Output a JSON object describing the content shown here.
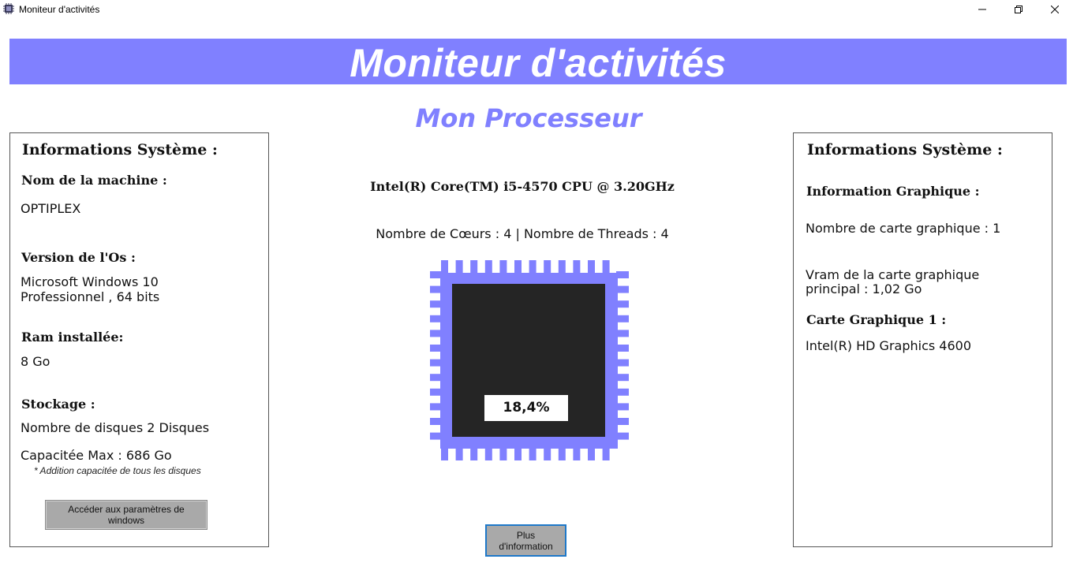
{
  "window": {
    "title": "Moniteur d'activités",
    "icons": {
      "app": "cpu-chip-icon",
      "minimize": "minimize-icon",
      "maximize": "restore-icon",
      "close": "close-icon"
    }
  },
  "banner": {
    "title": "Moniteur d'activités",
    "color": "#8080ff"
  },
  "subtitle": "Mon Processeur",
  "left_panel": {
    "title": "Informations Système :",
    "machine_heading": "Nom de la machine :",
    "machine_value": "OPTIPLEX",
    "os_heading": "Version de l'Os :",
    "os_value_line1": "Microsoft Windows 10",
    "os_value_line2": "Professionnel , 64 bits",
    "ram_heading": "Ram installée:",
    "ram_value": "8 Go",
    "storage_heading": "Stockage :",
    "disk_count": "Nombre de disques 2 Disques",
    "capacity": "Capacitée Max : 686 Go",
    "capacity_note": "* Addition capacitée de tous les disques",
    "settings_button_line1": "Accéder aux paramètres de",
    "settings_button_line2": "windows"
  },
  "center": {
    "cpu_name": "Intel(R) Core(TM) i5-4570 CPU @ 3.20GHz",
    "cores_threads": "Nombre de Cœurs : 4 | Nombre de Threads : 4",
    "cpu_usage": "18,4%",
    "chip_color": "#8080ff",
    "chip_core_color": "#252525",
    "more_button_line1": "Plus",
    "more_button_line2": "d'information"
  },
  "right_panel": {
    "title": "Informations Système :",
    "gpu_heading": "Information Graphique :",
    "gpu_count": "Nombre de carte graphique : 1",
    "vram_line1": "Vram de la carte graphique",
    "vram_line2": "principal : 1,02 Go",
    "card_heading": "Carte Graphique 1 :",
    "card_value": "Intel(R) HD Graphics 4600"
  }
}
